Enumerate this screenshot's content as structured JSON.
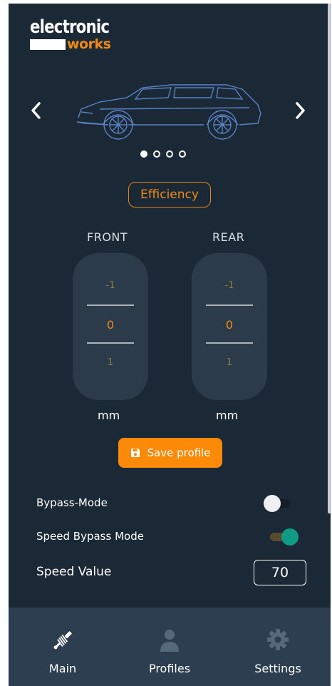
{
  "logo": {
    "line1": "electronic",
    "line2": "works"
  },
  "carousel": {
    "prev_icon": "chevron-left-icon",
    "next_icon": "chevron-right-icon",
    "prev": "‹",
    "next": "›",
    "dots_total": 4,
    "active_dot": 1
  },
  "profile_name": "Efficiency",
  "front": {
    "label": "FRONT",
    "above": "-1",
    "value": "0",
    "below": "1",
    "unit": "mm"
  },
  "rear": {
    "label": "REAR",
    "above": "-1",
    "value": "0",
    "below": "1",
    "unit": "mm"
  },
  "save_button": {
    "label": "Save profile",
    "icon": "floppy-disk-icon"
  },
  "bypass_mode": {
    "label": "Bypass-Mode",
    "on": false
  },
  "speed_bypass_mode": {
    "label": "Speed Bypass Mode",
    "on": true
  },
  "speed_value": {
    "label": "Speed Value",
    "value": "70"
  },
  "nav": [
    {
      "label": "Main",
      "icon": "shock-absorber-icon",
      "active": true
    },
    {
      "label": "Profiles",
      "icon": "person-icon",
      "active": false
    },
    {
      "label": "Settings",
      "icon": "gear-icon",
      "active": false
    }
  ],
  "colors": {
    "background": "#1b2835",
    "accent": "#fb8a09",
    "toggle_on": "#0f9b86",
    "navbar": "#2d3e50"
  }
}
